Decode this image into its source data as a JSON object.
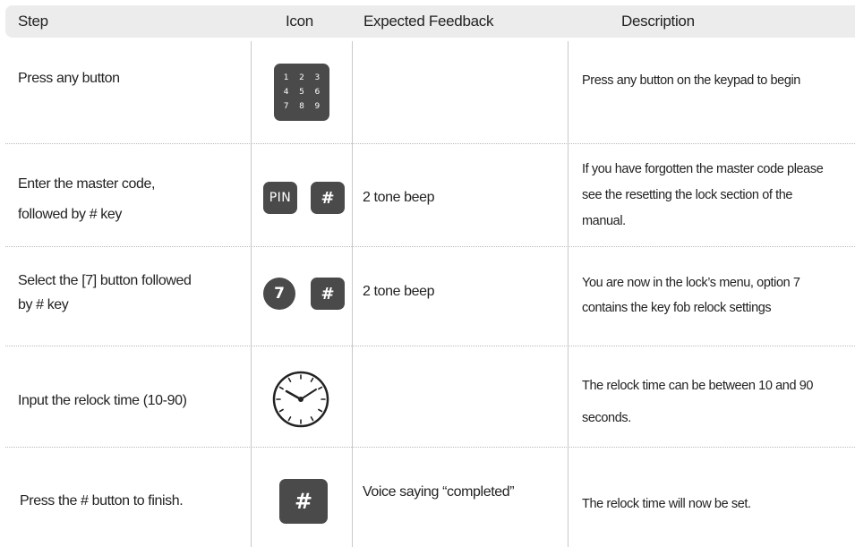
{
  "header": {
    "step": "Step",
    "icon": "Icon",
    "feedback": "Expected Feedback",
    "description": "Description"
  },
  "rows": [
    {
      "step_lines": [
        "Press any button"
      ],
      "icons": [
        "keypad-icon"
      ],
      "keypad_digits": [
        "1",
        "2",
        "3",
        "4",
        "5",
        "6",
        "7",
        "8",
        "9"
      ],
      "feedback": "",
      "description_lines": [
        "Press any button on the keypad to begin"
      ]
    },
    {
      "step_lines": [
        "Enter the master code,",
        "followed by # key"
      ],
      "icons": [
        "pin-icon",
        "hash-icon"
      ],
      "pin_label": "PIN",
      "hash_label": "#",
      "feedback": "2 tone beep",
      "description_lines": [
        "If you have forgotten the master code please",
        "see the resetting the lock section of the",
        "manual."
      ]
    },
    {
      "step_lines": [
        "Select the [7] button followed",
        "by # key"
      ],
      "icons": [
        "seven-button-icon",
        "hash-icon"
      ],
      "seven_label": "7",
      "hash_label": "#",
      "feedback": "2 tone beep",
      "description_lines": [
        "You are now in the lock’s menu, option 7",
        "contains the key fob  relock settings"
      ]
    },
    {
      "step_lines": [
        "Input the relock time (10-90)"
      ],
      "icons": [
        "clock-icon"
      ],
      "feedback": "",
      "description_lines": [
        "The relock time can be between 10 and 90",
        "seconds."
      ]
    },
    {
      "step_lines": [
        "Press the # button to finish."
      ],
      "icons": [
        "hash-icon"
      ],
      "hash_label": "#",
      "feedback": "Voice saying “completed”",
      "description_lines": [
        "The relock time will now be set."
      ]
    }
  ],
  "colors": {
    "header_bg": "#ececec",
    "icon_fill": "#4a4a4a",
    "divider": "#c8c8c8"
  }
}
